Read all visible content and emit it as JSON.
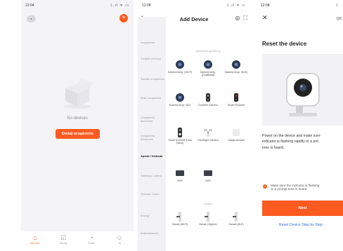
{
  "screen1": {
    "status_time": "12:04",
    "status_icons": "ᛒ.ıl ᯤ ▭",
    "empty_text": "No devices",
    "add_button": "Dodaj urządzenie",
    "tabs": [
      {
        "label": "Mój dom",
        "icon": "home-icon"
      },
      {
        "label": "Scena",
        "icon": "scene-icon"
      },
      {
        "label": "Smart",
        "icon": "smart-icon"
      },
      {
        "label": "Ja",
        "icon": "profile-icon"
      }
    ]
  },
  "screen2": {
    "status_time": "12:08",
    "status_icons": "ᛒ.ıl ᯤ ▭",
    "title": "Add Device",
    "categories": [
      "Urządzenie",
      "Czujnik ochrony",
      "Światło urządzenia",
      "Małe urządzenie",
      "Urządzenia kuchenne",
      "Urządzenia medyczne",
      "Aparat i blokada",
      "Gateway Control",
      "Outdoor Travel",
      "Energy",
      "Entertainment"
    ],
    "selected_category": 6,
    "sections": {
      "camera": "Aparat fotograficzny",
      "lock": "Zamek"
    },
    "devices": [
      {
        "name": "Kamera bezp. (Wi-Fi)",
        "kind": "camera"
      },
      {
        "name": "Kamera bezp. (DualBand)",
        "kind": "camera"
      },
      {
        "name": "Kamera bezp. (BLE)",
        "kind": "camera"
      },
      {
        "name": "Kamera bezp. (4G)",
        "kind": "camera"
      },
      {
        "name": "Doorbell Camera",
        "kind": "doorbell"
      },
      {
        "name": "Smart Doorbell",
        "kind": "doorbell"
      },
      {
        "name": "Smart Doorbell (Dual Band)",
        "kind": "doorbell-tall"
      },
      {
        "name": "Floodlight Camera",
        "kind": "floodlight"
      },
      {
        "name": "Stacja bazowa",
        "kind": "base"
      },
      {
        "name": "NVR",
        "kind": "recorder"
      },
      {
        "name": "DVR",
        "kind": "recorder"
      },
      {
        "name": "Zamek (Wi-Fi)",
        "kind": "lock"
      },
      {
        "name": "Zamek (Zigbee)",
        "kind": "lock"
      },
      {
        "name": "Zamek (BLE)",
        "kind": "lock"
      }
    ]
  },
  "screen3": {
    "status_time": "12:08",
    "status_icons": "ᛒ",
    "qr_label": "QR",
    "title": "Reset the device",
    "desc_lines": [
      "Power on the device and make sure",
      "indicator is flashing rapidly or a pro",
      "tone is heard."
    ],
    "check_lines": [
      "Make sure the indicator is flashing",
      "or a prompt tone is heard"
    ],
    "next_button": "Next",
    "reset_link": "Reset Device Step by Step"
  },
  "colors": {
    "accent": "#ff5a1f",
    "link": "#3b6fd6"
  }
}
